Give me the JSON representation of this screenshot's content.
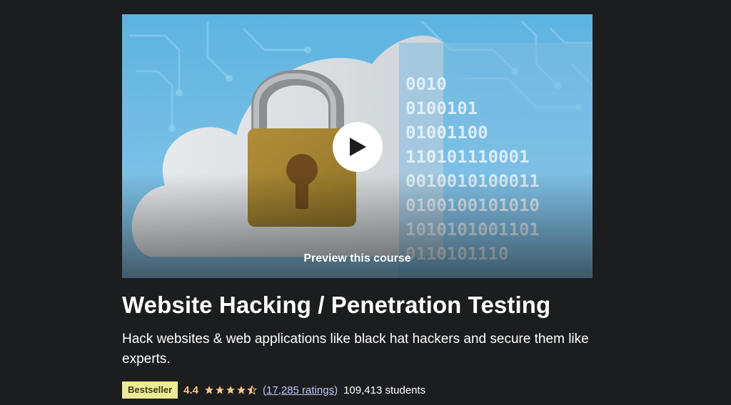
{
  "preview": {
    "label": "Preview this course",
    "binary_lines": [
      "0010",
      "0100101",
      "01001100",
      "110101110001",
      "0010010100011",
      "0100100101010",
      "1010101001101",
      "0110101110"
    ]
  },
  "course": {
    "title": "Website Hacking / Penetration Testing",
    "subtitle": "Hack websites & web applications like black hat hackers and secure them like experts.",
    "badge": "Bestseller",
    "rating": "4.4",
    "stars": 4.5,
    "ratings_count": "(17,285 ratings)",
    "students": "109,413 students"
  },
  "colors": {
    "background": "#1c1d1f",
    "badge_bg": "#eceb98",
    "rating": "#f3ca8c",
    "link": "#c0c4fc"
  },
  "icons": [
    "play-icon",
    "star-icon",
    "padlock-icon",
    "cloud-icon"
  ]
}
